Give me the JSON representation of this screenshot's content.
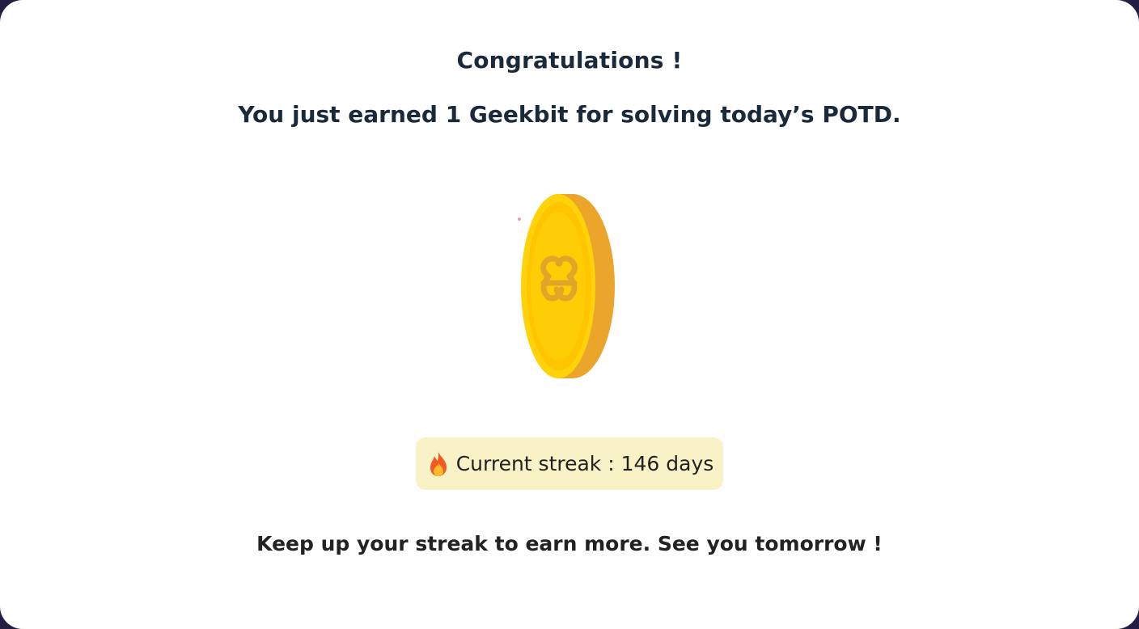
{
  "modal": {
    "title": "Congratulations !",
    "subtitle": "You just earned 1 Geekbit for solving today’s POTD.",
    "coin_icon": "geekbit-coin-icon",
    "streak": {
      "icon": "fire-icon",
      "text": "Current streak : 146 days"
    },
    "footer": "Keep up your streak to earn more. See you tomorrow !"
  },
  "colors": {
    "title": "#1b2a3a",
    "coin_face": "#ffc80a",
    "coin_edge": "#eba52a",
    "streak_bg": "#f8f2c6"
  }
}
